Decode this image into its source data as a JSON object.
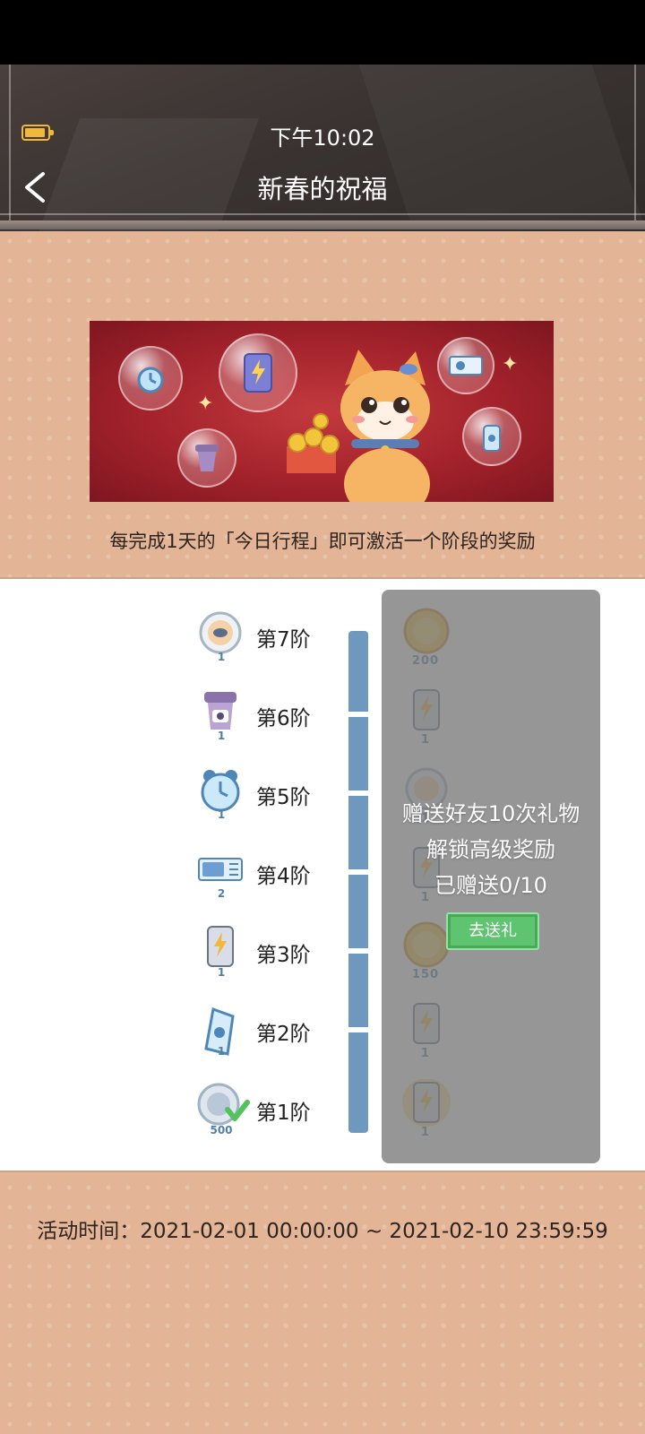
{
  "status_bar": {
    "time": "下午10:02",
    "battery_icon": "battery-icon"
  },
  "header": {
    "title": "新春的祝福",
    "back_icon": "chevron-left-icon"
  },
  "banner": {
    "image": "new-year-cat-banner"
  },
  "description": "每完成1天的「今日行程」即可激活一个阶段的奖励",
  "stages": [
    {
      "label": "第7阶",
      "count": "1",
      "icon": "fish-badge-icon"
    },
    {
      "label": "第6阶",
      "count": "1",
      "icon": "cup-icon"
    },
    {
      "label": "第5阶",
      "count": "1",
      "icon": "alarm-clock-icon"
    },
    {
      "label": "第4阶",
      "count": "2",
      "icon": "ticket-icon"
    },
    {
      "label": "第3阶",
      "count": "1",
      "icon": "power-bank-icon"
    },
    {
      "label": "第2阶",
      "count": "1",
      "icon": "tag-icon"
    },
    {
      "label": "第1阶",
      "count": "500",
      "icon": "silver-coin-check-icon"
    }
  ],
  "advanced_rewards": [
    {
      "count": "200",
      "icon": "gold-coin-icon"
    },
    {
      "count": "1",
      "icon": "power-bank-icon"
    },
    {
      "count": "1",
      "icon": "fish-badge-icon"
    },
    {
      "count": "1",
      "icon": "power-bank-icon"
    },
    {
      "count": "150",
      "icon": "gold-coin-icon"
    },
    {
      "count": "1",
      "icon": "power-bank-icon"
    },
    {
      "count": "1",
      "icon": "power-bank-glow-icon"
    }
  ],
  "lock_overlay": {
    "line1": "赠送好友10次礼物",
    "line2": "解锁高级奖励",
    "line3": "已赠送0/10",
    "button": "去送礼"
  },
  "activity_time": "活动时间：2021-02-01 00:00:00 ~ 2021-02-10 23:59:59",
  "colors": {
    "header_bg": "#3a3331",
    "page_bg": "#e3b596",
    "track": "#6f98be",
    "button_green": "#5ec46f",
    "battery": "#f1b83c"
  }
}
